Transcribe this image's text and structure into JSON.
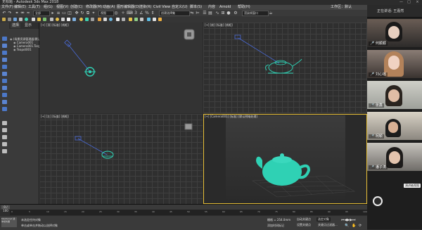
{
  "window": {
    "title": "无标题 - Autodesk 3ds Max 2018",
    "controls": [
      "—",
      "□",
      "×"
    ]
  },
  "menubar": {
    "items": [
      "文件(F)",
      "编辑(E)",
      "工具(T)",
      "组(G)",
      "视图(V)",
      "创建(C)",
      "修改器(M)",
      "动画(A)",
      "图形编辑器(D)",
      "渲染(R)",
      "Civil View",
      "自定义(U)",
      "脚本(S)",
      "内容",
      "Arnold",
      "帮助(H)"
    ],
    "workspace_label": "工作区：默认"
  },
  "toolbar": {
    "selection_filter": "全部",
    "view_dropdown": "视图",
    "named_selection": "创建选择集",
    "render_region": "渲染帧窗口"
  },
  "scene_explorer": {
    "tabs": [
      "选择",
      "显示"
    ],
    "tree": [
      {
        "label": "(场景资源管理器)默认"
      },
      {
        "label": "Camera001"
      },
      {
        "label": "Camera001.Target"
      },
      {
        "label": "Teapot001"
      }
    ]
  },
  "viewports": {
    "top": "[+] [顶] [标准] [线框]",
    "front": "[+] [前] [标准] [线框]",
    "left": "[+] [左] [标准] [线框]",
    "camera": "[+] [Camera001] [标准] [默认明暗处理]"
  },
  "status": {
    "frame_counter": "0 / 100",
    "selection_status": "未选定任何对象",
    "prompt": "单击或单击并拖动以选择对象",
    "add_time_tag": "添加时间标记",
    "auto_key": "自动关键点",
    "set_key": "设置关键点",
    "selected_object": "选定对象",
    "key_filters": "关键点过滤器...",
    "grid": "栅格 = 254.0mm",
    "maxscript": "MAXScript 迷你侦听器",
    "timeline_ticks": [
      "0",
      "5",
      "10",
      "15",
      "20",
      "25",
      "30",
      "35",
      "40",
      "45",
      "50",
      "55",
      "60",
      "65",
      "70",
      "75",
      "80",
      "85",
      "90",
      "95",
      "100"
    ]
  },
  "meeting_panel": {
    "header": "正在讲话: 王嘉然",
    "participants": [
      {
        "name": "何顺顺"
      },
      {
        "name": "刘心瑶"
      },
      {
        "name": "张鑫"
      },
      {
        "name": "柯颖"
      },
      {
        "name": "潘子涛"
      }
    ],
    "speaker_view": "演讲者视图"
  },
  "colors": {
    "teapot": "#2fd1b4",
    "camera": "#4a6bd8",
    "active_border": "#e8c038",
    "ui_dark": "#2b2b2b"
  }
}
